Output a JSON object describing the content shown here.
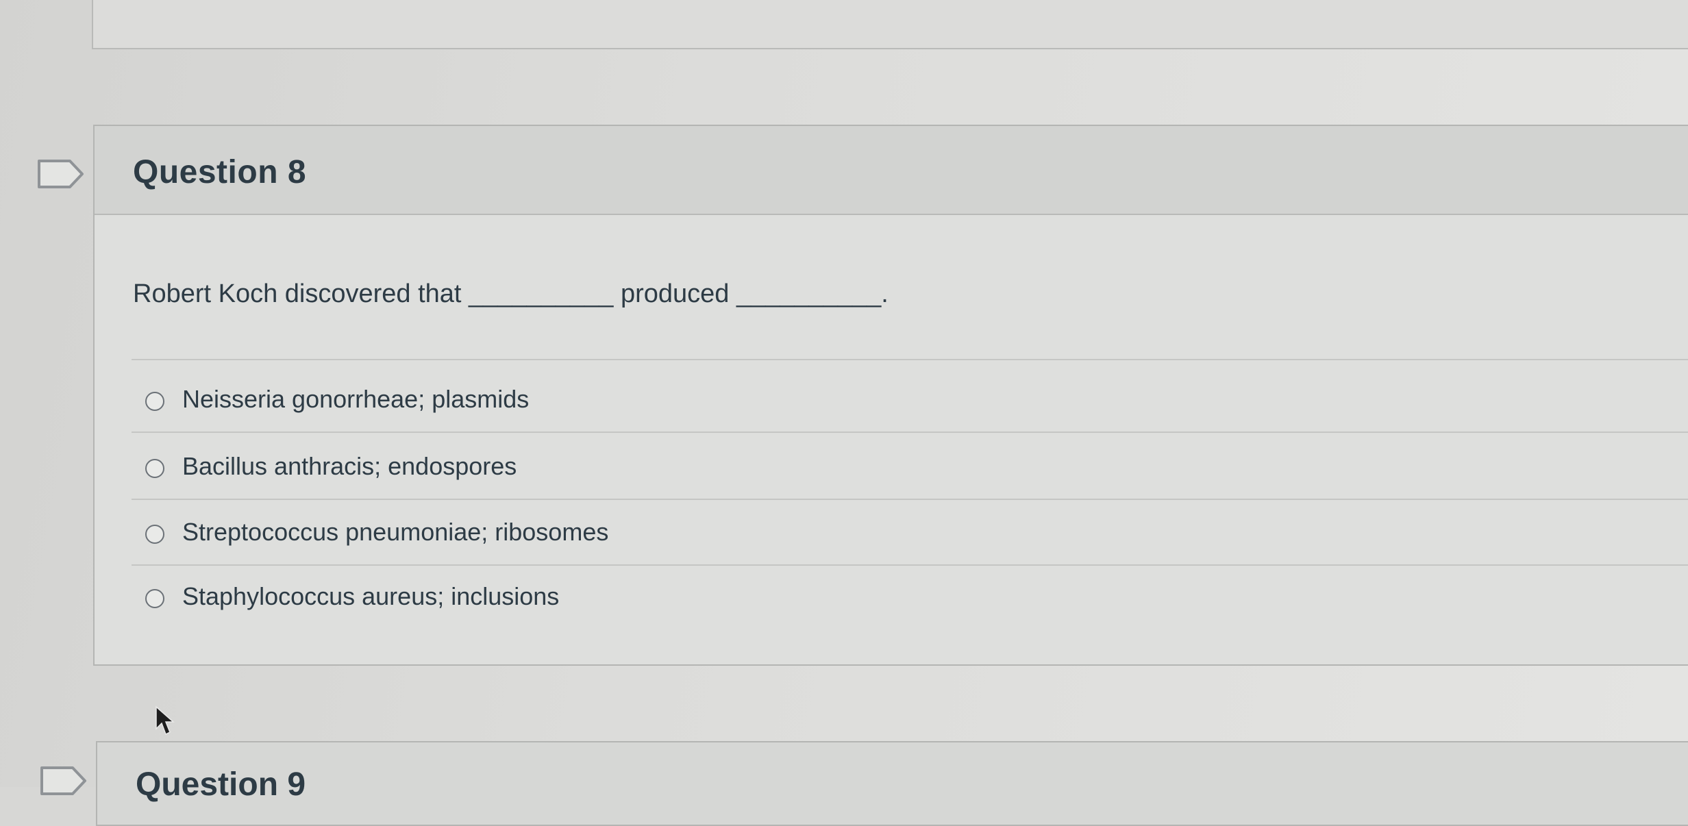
{
  "question": {
    "title": "Question 8",
    "text": "Robert Koch discovered that __________ produced __________.",
    "answers": [
      {
        "label": "Neisseria gonorrheae; plasmids",
        "selected": false
      },
      {
        "label": "Bacillus anthracis; endospores",
        "selected": false
      },
      {
        "label": "Streptococcus pneumoniae; ribosomes",
        "selected": false
      },
      {
        "label": "Staphylococcus aureus; inclusions",
        "selected": false
      }
    ]
  },
  "next_question": {
    "title": "Question 9"
  },
  "icons": {
    "flag": "bookmark-flag-icon",
    "radio": "radio-unselected-icon",
    "cursor": "mouse-pointer-icon"
  },
  "colors": {
    "text": "#2d3b45",
    "card_border": "#b4b5b3",
    "header_bg": "#d2d3d1"
  }
}
